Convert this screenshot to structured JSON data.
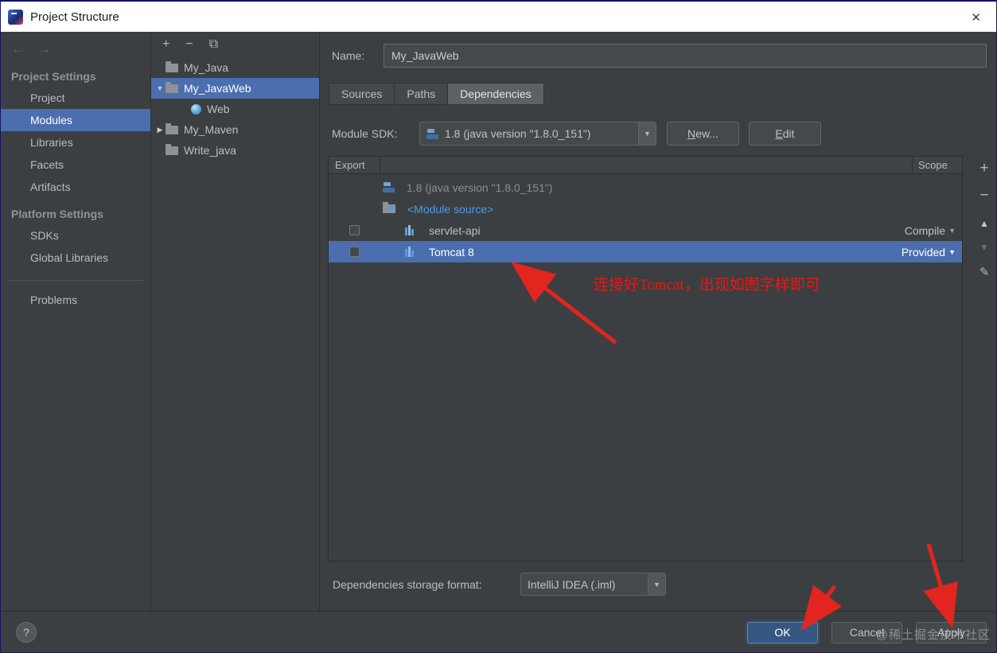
{
  "window": {
    "title": "Project Structure"
  },
  "icons": {
    "close": "✕",
    "back": "←",
    "forward": "→",
    "add": "+",
    "remove": "−",
    "copy": "⧉",
    "move_up": "▲",
    "move_down": "▼",
    "edit_pencil": "✎",
    "expand": "▼",
    "collapse": "▶",
    "dropdown": "▼",
    "help": "?"
  },
  "sidebar": {
    "section_project": "Project Settings",
    "project_items": [
      "Project",
      "Modules",
      "Libraries",
      "Facets",
      "Artifacts"
    ],
    "selected_item": "Modules",
    "section_platform": "Platform Settings",
    "platform_items": [
      "SDKs",
      "Global Libraries"
    ],
    "problems": "Problems"
  },
  "module_tree": {
    "selected": "My_JavaWeb",
    "items": [
      {
        "label": "My_Java"
      },
      {
        "label": "My_JavaWeb"
      },
      {
        "label": "Web"
      },
      {
        "label": "My_Maven"
      },
      {
        "label": "Write_java"
      }
    ]
  },
  "main": {
    "name_label": "Name:",
    "name_value": "My_JavaWeb",
    "tabs": [
      "Sources",
      "Paths",
      "Dependencies"
    ],
    "selected_tab": "Dependencies",
    "sdk_label": "Module SDK:",
    "sdk_value": "1.8 (java version \"1.8.0_151\")",
    "new_button": "New...",
    "edit_button": "Edit",
    "table": {
      "export_header": "Export",
      "scope_header": "Scope",
      "rows": [
        {
          "text": "1.8 (java version \"1.8.0_151\")",
          "scope": ""
        },
        {
          "text": "<Module source>",
          "scope": ""
        },
        {
          "text": "servlet-api",
          "scope": "Compile"
        },
        {
          "text": "Tomcat 8",
          "scope": "Provided"
        }
      ]
    },
    "storage_label": "Dependencies storage format:",
    "storage_value": "IntelliJ IDEA (.iml)",
    "annotation_text": "连接好Tomcat，出现如图字样即可"
  },
  "footer": {
    "ok": "OK",
    "cancel": "Cancel",
    "apply": "Apply",
    "watermark": "@稀土掘金技术社区"
  }
}
